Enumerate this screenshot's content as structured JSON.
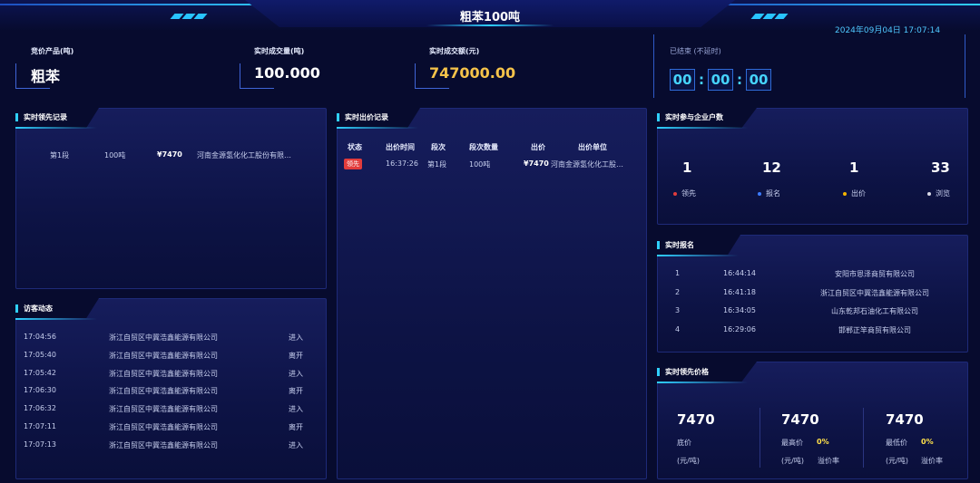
{
  "header": {
    "title": "粗苯100吨",
    "datetime": "2024年09月04日 17:07:14"
  },
  "stats": {
    "product_label": "竞价产品(吨)",
    "product_value": "粗苯",
    "volume_label": "实时成交量(吨)",
    "volume_value": "100.000",
    "amount_label": "实时成交额(元)",
    "amount_value": "747000.00"
  },
  "countdown": {
    "status": "已结束 (不延时)",
    "hours": "00",
    "minutes": "00",
    "seconds": "00",
    "separator": ":"
  },
  "lead_records": {
    "title": "实时领先记录",
    "rows": [
      {
        "segment": "第1段",
        "quantity": "100吨",
        "price": "¥7470",
        "company": "河南金源氢化化工股份有限…"
      }
    ]
  },
  "bid_records": {
    "title": "实时出价记录",
    "headers": [
      "状态",
      "出价时间",
      "段次",
      "段次数量",
      "出价",
      "出价单位"
    ],
    "rows": [
      {
        "status": "领先",
        "time": "16:37:26",
        "segment": "第1段",
        "quantity": "100吨",
        "price": "¥7470",
        "company": "河南金源氢化化工股…"
      }
    ]
  },
  "visitors": {
    "title": "访客动态",
    "rows": [
      {
        "time": "17:04:56",
        "company": "浙江自贸区中冀浩鑫能源有限公司",
        "action": "进入"
      },
      {
        "time": "17:05:40",
        "company": "浙江自贸区中冀浩鑫能源有限公司",
        "action": "离开"
      },
      {
        "time": "17:05:42",
        "company": "浙江自贸区中冀浩鑫能源有限公司",
        "action": "进入"
      },
      {
        "time": "17:06:30",
        "company": "浙江自贸区中冀浩鑫能源有限公司",
        "action": "离开"
      },
      {
        "time": "17:06:32",
        "company": "浙江自贸区中冀浩鑫能源有限公司",
        "action": "进入"
      },
      {
        "time": "17:07:11",
        "company": "浙江自贸区中冀浩鑫能源有限公司",
        "action": "离开"
      },
      {
        "time": "17:07:13",
        "company": "浙江自贸区中冀浩鑫能源有限公司",
        "action": "进入"
      }
    ]
  },
  "participants": {
    "title": "实时参与企业户数",
    "items": [
      {
        "value": "1",
        "label": "领先",
        "color": "#e23c3c"
      },
      {
        "value": "12",
        "label": "报名",
        "color": "#3c7bff"
      },
      {
        "value": "1",
        "label": "出价",
        "color": "#f5b400"
      },
      {
        "value": "33",
        "label": "浏览",
        "color": "#d9d9e6"
      }
    ]
  },
  "registrations": {
    "title": "实时报名",
    "rows": [
      {
        "index": "1",
        "time": "16:44:14",
        "company": "安阳市恩泽商贸有限公司"
      },
      {
        "index": "2",
        "time": "16:41:18",
        "company": "浙江自贸区中冀浩鑫能源有限公司"
      },
      {
        "index": "3",
        "time": "16:34:05",
        "company": "山东乾邦石油化工有限公司"
      },
      {
        "index": "4",
        "time": "16:29:06",
        "company": "邯郸正竿商贸有限公司"
      }
    ]
  },
  "lead_price": {
    "title": "实时领先价格",
    "base": {
      "value": "7470",
      "label": "底价",
      "unit": "(元/吨)"
    },
    "highest": {
      "value": "7470",
      "label": "最高价",
      "rate": "0%",
      "unit": "(元/吨)",
      "rate_label": "溢价率"
    },
    "lowest": {
      "value": "7470",
      "label": "最低价",
      "rate": "0%",
      "unit": "(元/吨)",
      "rate_label": "溢价率"
    }
  }
}
